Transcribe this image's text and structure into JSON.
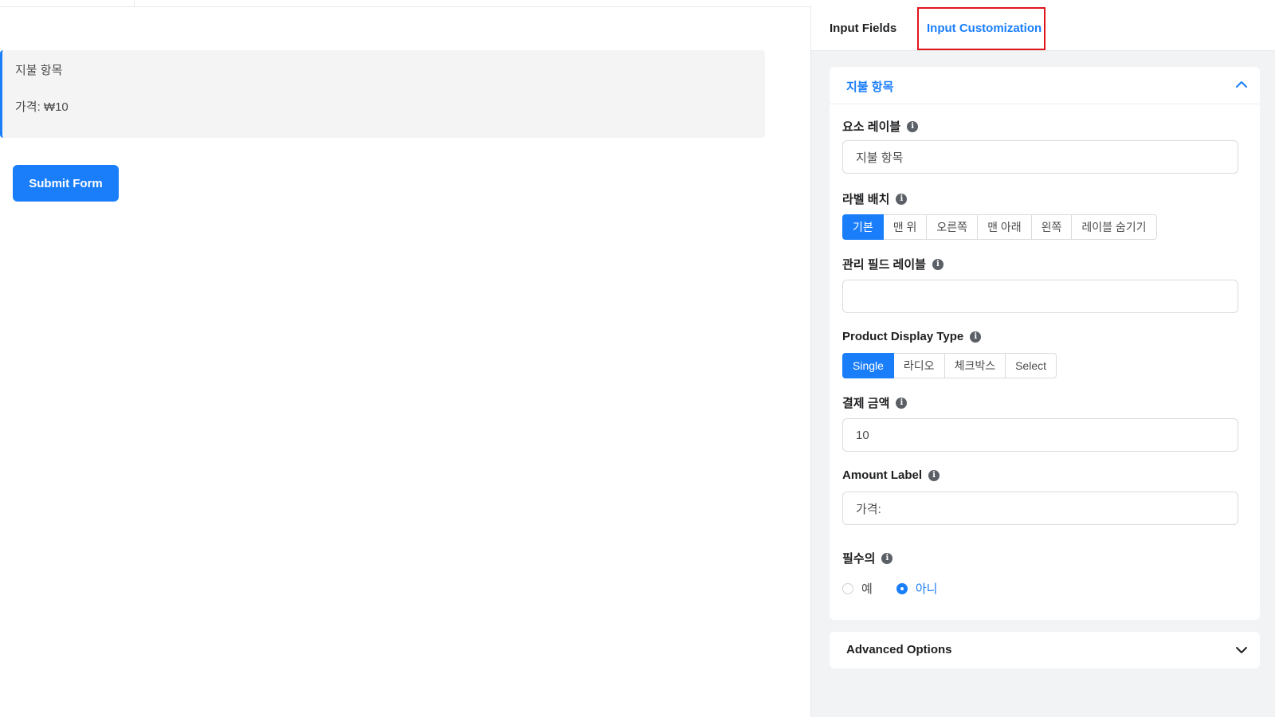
{
  "preview": {
    "item_label": "지불 항목",
    "price_text": "가격: ₩10",
    "submit_label": "Submit Form"
  },
  "tabs": {
    "input_fields": "Input Fields",
    "input_customization": "Input Customization"
  },
  "card": {
    "title": "지불 항목",
    "element_label": {
      "label": "요소 레이블",
      "value": "지불 항목"
    },
    "label_placement": {
      "label": "라벨 배치",
      "options": [
        "기본",
        "맨 위",
        "오른쪽",
        "맨 아래",
        "왼쪽",
        "레이블 숨기기"
      ],
      "selected": "기본"
    },
    "admin_field_label": {
      "label": "관리 필드 레이블",
      "value": ""
    },
    "product_display_type": {
      "label": "Product Display Type",
      "options": [
        "Single",
        "라디오",
        "체크박스",
        "Select"
      ],
      "selected": "Single"
    },
    "payment_amount": {
      "label": "결제 금액",
      "value": "10"
    },
    "amount_label": {
      "label": "Amount Label",
      "value": "가격:"
    },
    "required": {
      "label": "필수의",
      "options": [
        "예",
        "아니"
      ],
      "selected": "아니"
    }
  },
  "advanced": {
    "title": "Advanced Options"
  },
  "colors": {
    "accent": "#1a7efb",
    "highlight": "#e0151b"
  }
}
